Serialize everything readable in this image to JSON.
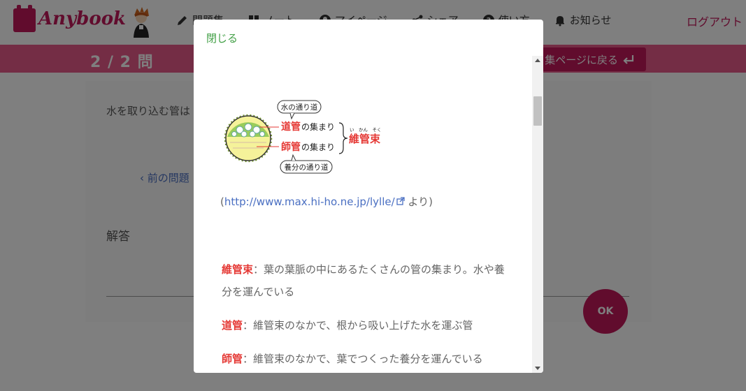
{
  "header": {
    "logo_text": "Anybook",
    "nav": [
      {
        "label": "問題集",
        "icon": "pencil-icon"
      },
      {
        "label": "ノート",
        "icon": "book-icon"
      },
      {
        "label": "マイページ",
        "icon": "user-icon"
      },
      {
        "label": "シェア",
        "icon": "share-icon"
      },
      {
        "label": "使い方",
        "icon": "question-icon"
      },
      {
        "label": "お知らせ",
        "icon": "bell-icon"
      }
    ],
    "logout": "ログアウト"
  },
  "quiz_bar": {
    "counter": "2 / 2 問",
    "back_label": "集ページに戻る"
  },
  "main": {
    "question_text": "水を取り込む管は",
    "prev_link": "前の問題",
    "answer_label": "解答",
    "ok_label": "OK"
  },
  "modal": {
    "close_label": "閉じる",
    "diagram": {
      "callout_top": "水の通り道",
      "callout_bottom": "養分の通り道",
      "label_vessel_term": "道管",
      "label_vessel_rest": "の集まり",
      "label_phloem_term": "師管",
      "label_phloem_rest": "の集まり",
      "bundle_label": "維管束",
      "bundle_ruby": "い　かん　そく"
    },
    "credit_open": "(",
    "credit_url": "http://www.max.hi-ho.ne.jp/lylle/",
    "credit_close": " より)",
    "definitions": [
      {
        "term": "維管束",
        "text": "：葉の葉脈の中にあるたくさんの管の集まり。水や養分を運んでいる"
      },
      {
        "term": "道管",
        "text": "：維管束のなかで、根から吸い上げた水を運ぶ管"
      },
      {
        "term": "師管",
        "text": "：維管束のなかで、葉でつくった養分を運んでいる"
      }
    ]
  },
  "colors": {
    "brand": "#c2185b",
    "bar": "#e85a8a",
    "close_link": "#43a047",
    "term_red": "#e53935"
  }
}
